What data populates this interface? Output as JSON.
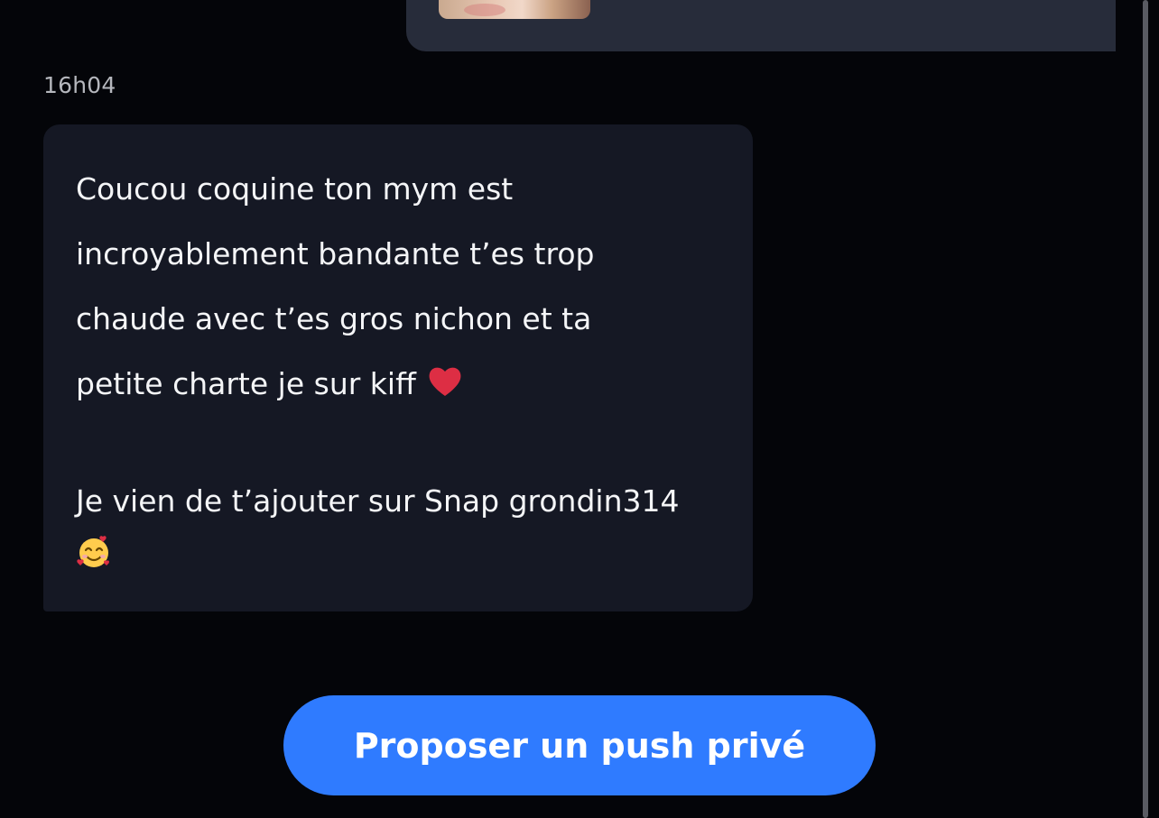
{
  "conversation": {
    "timestamp": "16h04",
    "message": {
      "lines": [
        "Coucou coquine ton mym est",
        "incroyablement bandante t’es trop",
        "chaude avec t’es gros nichon et ta",
        "petite charte je sur kiff"
      ],
      "second_paragraph": "Je vien de t’ajouter sur Snap grondin314",
      "emoji_after_first": "red-heart-icon",
      "emoji_after_second": "smiling-face-with-hearts-icon"
    }
  },
  "actions": {
    "propose_push_label": "Proposer un push privé"
  },
  "colors": {
    "background": "#040509",
    "sent_bubble": "#272c3a",
    "received_bubble": "#151824",
    "accent": "#2f7bff",
    "timestamp_text": "#b5b7bd"
  }
}
